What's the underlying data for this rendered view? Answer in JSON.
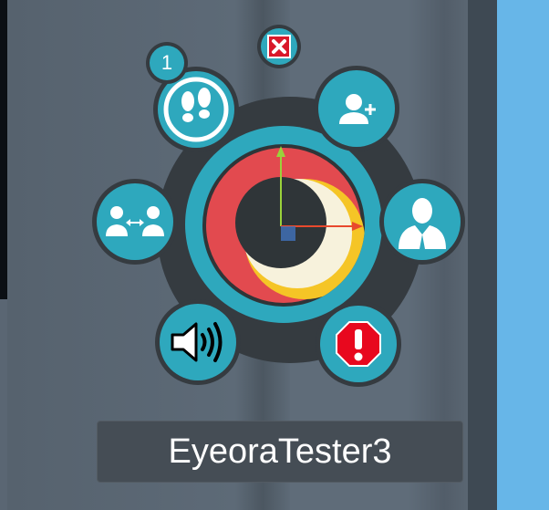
{
  "colors": {
    "teal": "#2ea8bd",
    "dark_ring": "#353b40",
    "alert_red": "#e8081e",
    "close_red": "#d9182a",
    "background": "#5a6673",
    "sky": "#67b6e8"
  },
  "menu": {
    "notification_count": "1",
    "buttons": [
      {
        "name": "footsteps",
        "icon": "footprints-icon"
      },
      {
        "name": "add-friend",
        "icon": "add-person-icon"
      },
      {
        "name": "swap-users",
        "icon": "user-swap-icon"
      },
      {
        "name": "profile",
        "icon": "person-icon"
      },
      {
        "name": "audio",
        "icon": "speaker-icon"
      },
      {
        "name": "report",
        "icon": "warning-octagon-icon"
      },
      {
        "name": "close",
        "icon": "close-icon"
      }
    ]
  },
  "player": {
    "name": "EyeoraTester3"
  }
}
